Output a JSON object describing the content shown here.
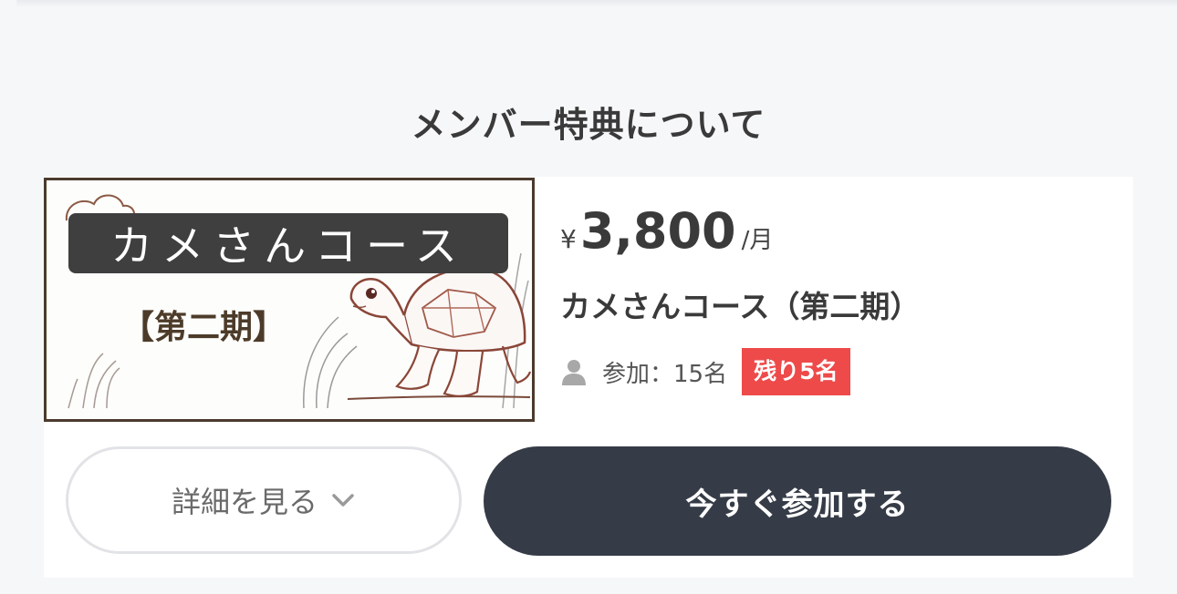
{
  "section": {
    "title": "メンバー特典について"
  },
  "plan": {
    "thumbnail_title": "カメさんコース",
    "thumbnail_subtitle": "【第二期】",
    "currency": "¥",
    "price": "3,800",
    "unit": "/月",
    "name": "カメさんコース（第二期）",
    "participants": "参加：15名",
    "remaining": "残り5名"
  },
  "buttons": {
    "detail_label": "詳細を見る",
    "join_label": "今すぐ参加する"
  },
  "icons": {
    "participants": "user-icon",
    "detail_toggle": "chevron-down-icon"
  },
  "colors": {
    "accent_dark": "#363c47",
    "remaining_badge": "#ee4a4a",
    "page_bg": "#f6f7f9"
  }
}
